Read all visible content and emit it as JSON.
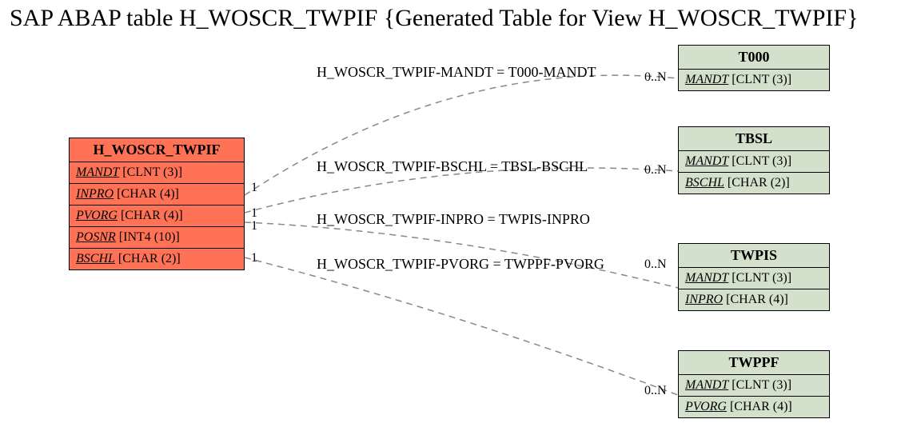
{
  "title": "SAP ABAP table H_WOSCR_TWPIF {Generated Table for View H_WOSCR_TWPIF}",
  "main": {
    "name": "H_WOSCR_TWPIF",
    "fields": {
      "mandt": {
        "name": "MANDT",
        "type": "[CLNT (3)]"
      },
      "inpro": {
        "name": "INPRO",
        "type": "[CHAR (4)]"
      },
      "pvorg": {
        "name": "PVORG",
        "type": "[CHAR (4)]"
      },
      "posnr": {
        "name": "POSNR",
        "type": "[INT4 (10)]"
      },
      "bschl": {
        "name": "BSCHL",
        "type": "[CHAR (2)]"
      }
    }
  },
  "refs": {
    "t000": {
      "name": "T000",
      "fields": {
        "mandt": {
          "name": "MANDT",
          "type": "[CLNT (3)]"
        }
      }
    },
    "tbsl": {
      "name": "TBSL",
      "fields": {
        "mandt": {
          "name": "MANDT",
          "type": "[CLNT (3)]"
        },
        "bschl": {
          "name": "BSCHL",
          "type": "[CHAR (2)]"
        }
      }
    },
    "twpis": {
      "name": "TWPIS",
      "fields": {
        "mandt": {
          "name": "MANDT",
          "type": "[CLNT (3)]"
        },
        "inpro": {
          "name": "INPRO",
          "type": "[CHAR (4)]"
        }
      }
    },
    "twppf": {
      "name": "TWPPF",
      "fields": {
        "mandt": {
          "name": "MANDT",
          "type": "[CLNT (3)]"
        },
        "pvorg": {
          "name": "PVORG",
          "type": "[CHAR (4)]"
        }
      }
    }
  },
  "rels": {
    "r1": {
      "label": "H_WOSCR_TWPIF-MANDT = T000-MANDT",
      "left": "1",
      "right": "0..N"
    },
    "r2": {
      "label": "H_WOSCR_TWPIF-BSCHL = TBSL-BSCHL",
      "left": "1",
      "right": "0..N"
    },
    "r3": {
      "label": "H_WOSCR_TWPIF-INPRO = TWPIS-INPRO",
      "left": "1",
      "right": "0..N"
    },
    "r4": {
      "label": "H_WOSCR_TWPIF-PVORG = TWPPF-PVORG",
      "left": "1",
      "right": "0..N"
    }
  }
}
